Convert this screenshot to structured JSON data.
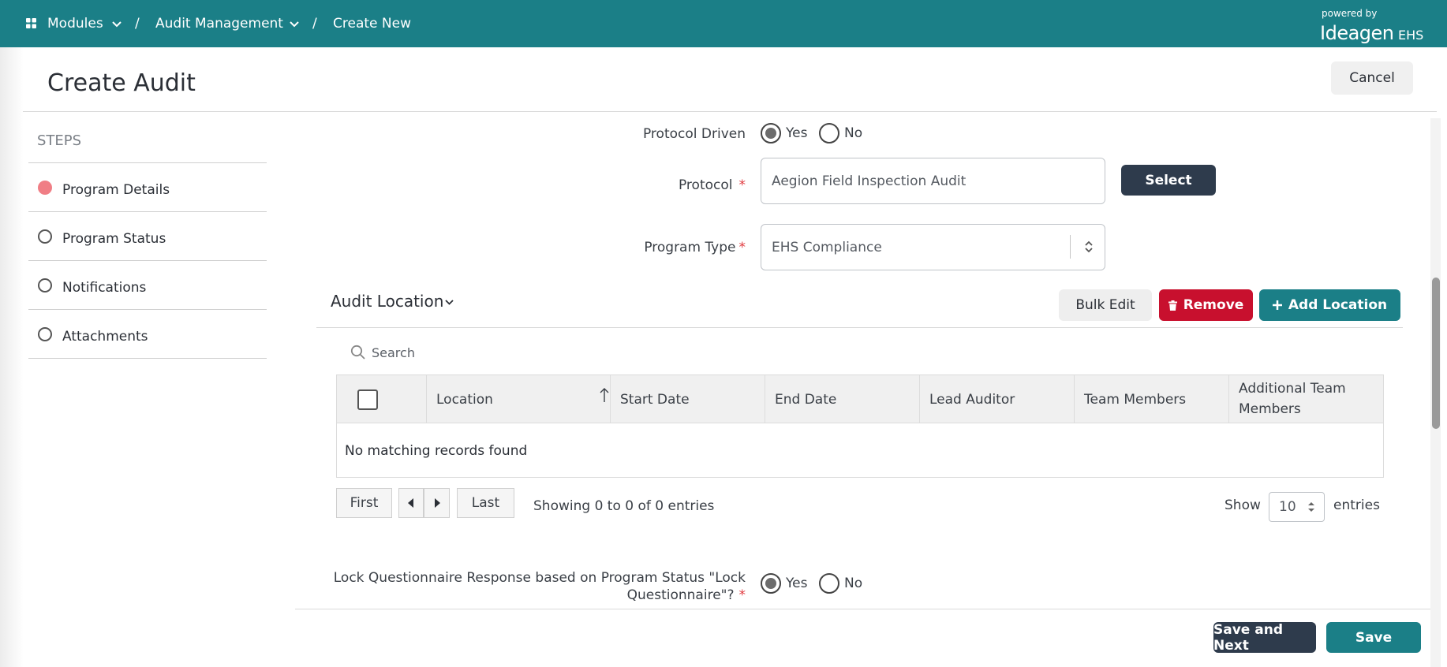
{
  "header": {
    "breadcrumb": [
      "Modules",
      "Audit Management",
      "Create New"
    ],
    "separator": "/",
    "powered_by": "powered by",
    "brand": "Ideagen",
    "brand_suffix": "EHS",
    "bg_color": "#1b7f87"
  },
  "page": {
    "title": "Create Audit",
    "cancel_label": "Cancel"
  },
  "steps": {
    "heading": "STEPS",
    "items": [
      {
        "label": "Program Details",
        "active": true
      },
      {
        "label": "Program Status",
        "active": false
      },
      {
        "label": "Notifications",
        "active": false
      },
      {
        "label": "Attachments",
        "active": false
      }
    ]
  },
  "form": {
    "protocol_driven": {
      "label": "Protocol Driven",
      "yes": "Yes",
      "no": "No",
      "selected": "Yes"
    },
    "protocol": {
      "label": "Protocol",
      "required_mark": "*",
      "value": "Aegion Field Inspection Audit",
      "select_label": "Select"
    },
    "program_type": {
      "label": "Program Type",
      "required_mark": "*",
      "value": "EHS Compliance"
    },
    "lock_questionnaire": {
      "label_line1": "Lock Questionnaire Response based on Program Status \"Lock",
      "label_line2": "Questionnaire\"?",
      "required_mark": "*",
      "yes": "Yes",
      "no": "No",
      "selected": "Yes"
    }
  },
  "audit_location": {
    "title": "Audit Location",
    "bulk_edit": "Bulk Edit",
    "remove": "Remove",
    "add_location": "Add Location",
    "search_placeholder": "Search",
    "columns": [
      "Location",
      "Start Date",
      "End Date",
      "Lead Auditor",
      "Team Members",
      "Additional Team Members"
    ],
    "additional_line1": "Additional Team",
    "additional_line2": "Members",
    "empty_message": "No matching records found",
    "pagination": {
      "first": "First",
      "last": "Last",
      "info": "Showing 0 to 0 of 0 entries",
      "show": "Show",
      "page_size": "10",
      "entries": "entries"
    }
  },
  "footer": {
    "save_next": "Save and Next",
    "save": "Save"
  },
  "colors": {
    "teal": "#1b7f87",
    "dark": "#2e3b4c",
    "red": "#c8102e",
    "active_step": "#f07e85"
  }
}
